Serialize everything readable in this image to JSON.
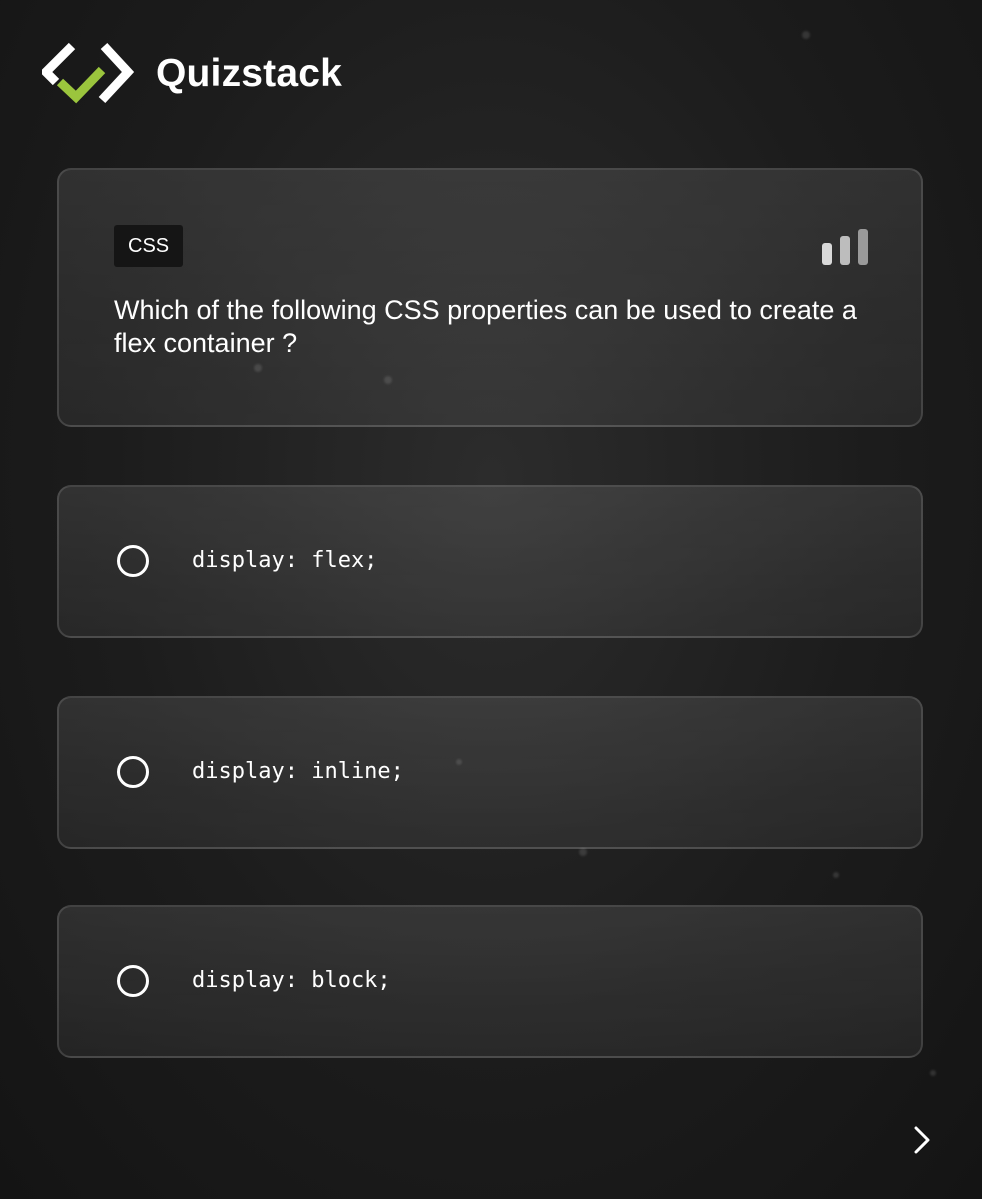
{
  "app": {
    "title": "Quizstack",
    "accent_color": "#9bc53d",
    "logo_icon": "check-brackets-logo"
  },
  "question": {
    "category": "CSS",
    "difficulty_icon": "signal-bars-icon",
    "text": "Which of the following CSS properties can be used to create a flex container ?"
  },
  "options": [
    {
      "label": "display: flex;",
      "selected": false
    },
    {
      "label": "display: inline;",
      "selected": false
    },
    {
      "label": "display: block;",
      "selected": false
    }
  ],
  "navigation": {
    "next_icon": "chevron-right-icon"
  }
}
